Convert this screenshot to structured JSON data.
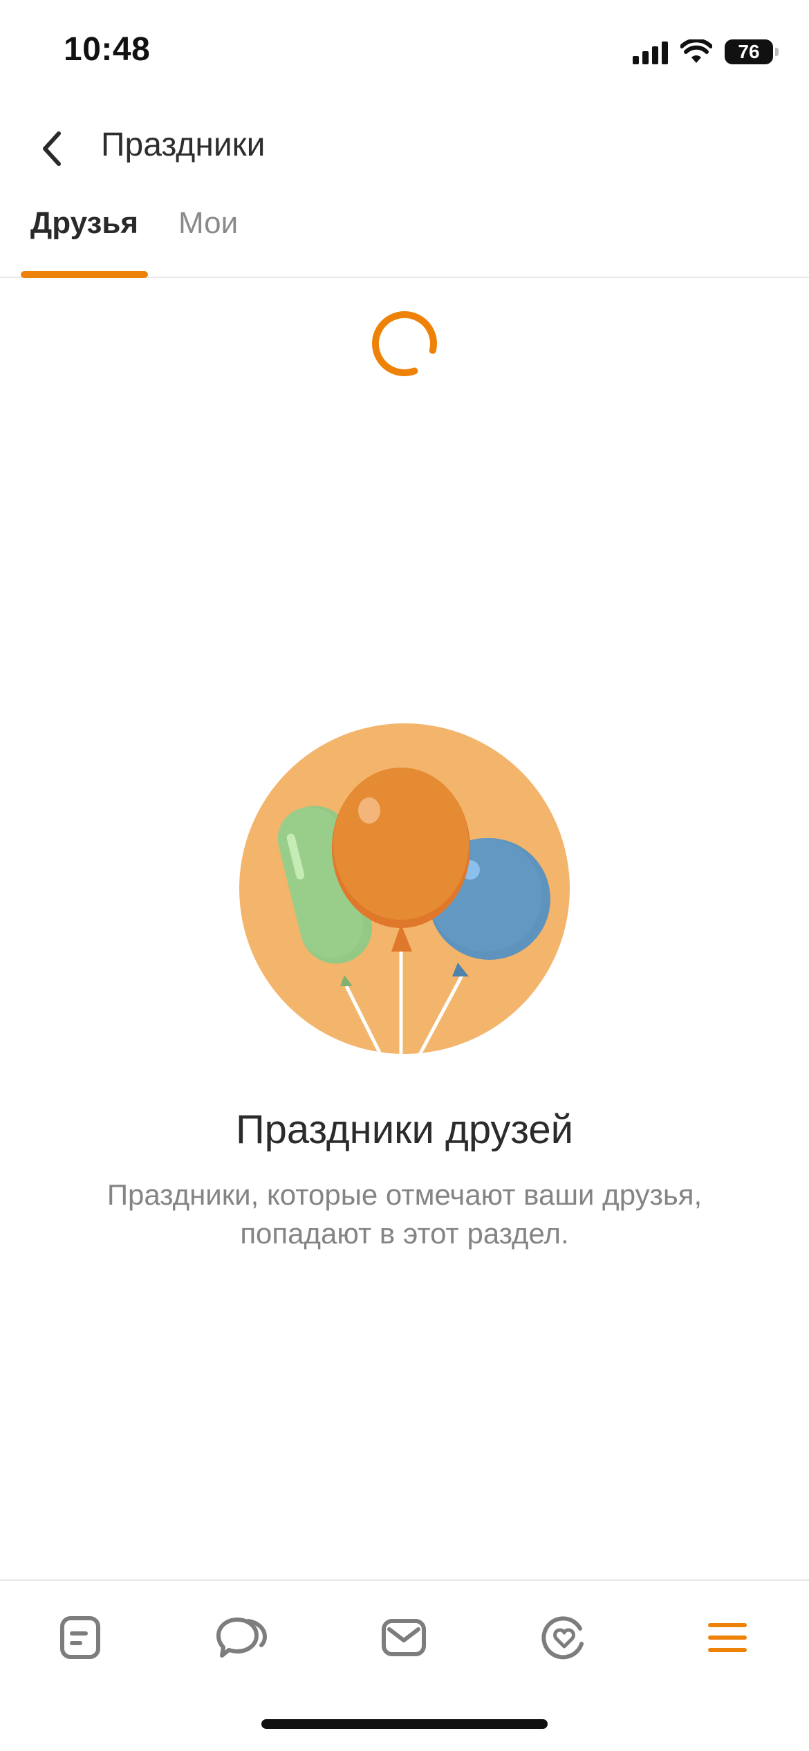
{
  "status_bar": {
    "time": "10:48",
    "battery": "76"
  },
  "header": {
    "title": "Праздники",
    "back_icon": "chevron-left-icon"
  },
  "tabs": [
    {
      "label": "Друзья",
      "active": true
    },
    {
      "label": "Мои",
      "active": false
    }
  ],
  "empty_state": {
    "title": "Праздники друзей",
    "description": "Праздники, которые отмечают ваши друзья, попадают в этот раздел.",
    "illustration": "balloons-illustration"
  },
  "bottom_nav": [
    {
      "icon": "feed-icon",
      "active": false
    },
    {
      "icon": "discussions-icon",
      "active": false
    },
    {
      "icon": "messages-icon",
      "active": false
    },
    {
      "icon": "notifications-heart-icon",
      "active": false
    },
    {
      "icon": "menu-icon",
      "active": true
    }
  ],
  "colors": {
    "accent": "#ee8208",
    "illustration_bg": "#f3b56b",
    "balloon_orange": "#e58b34",
    "balloon_green": "#93c985",
    "balloon_blue": "#5e93bd",
    "inactive_icon": "#7d7d7d"
  }
}
